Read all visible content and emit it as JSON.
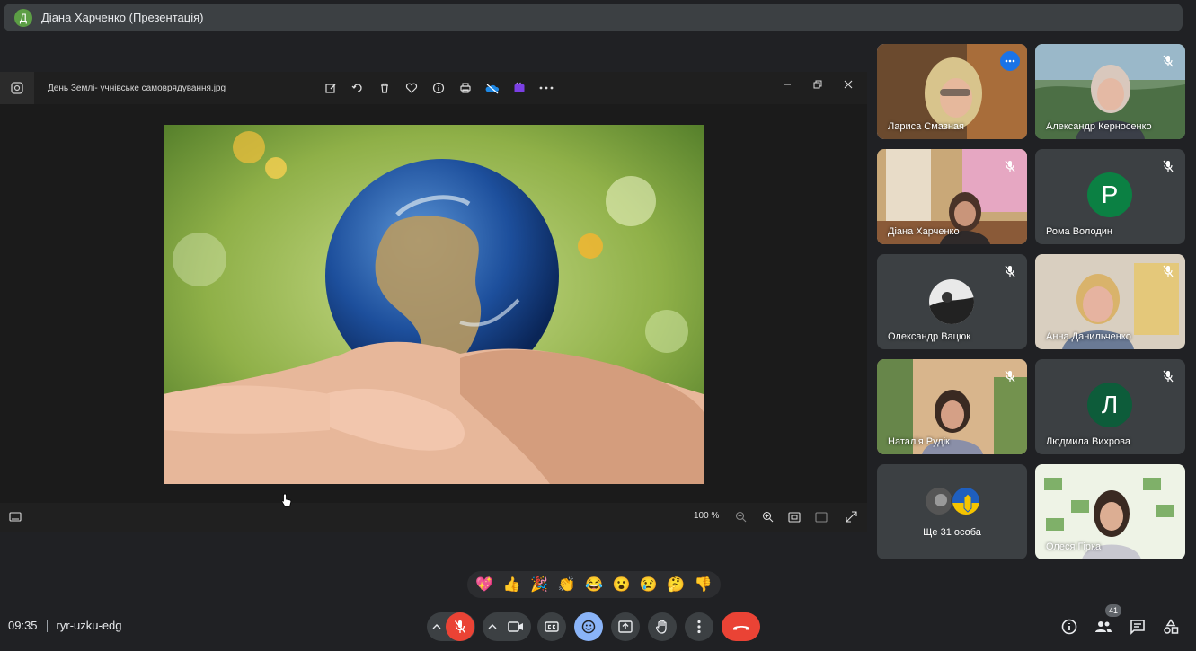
{
  "presenter": {
    "initial": "Д",
    "title": "Діана Харченко (Презентація)"
  },
  "viewer": {
    "file_name": "День Землі- учнівське самоврядування.jpg",
    "tools": [
      "edit-icon",
      "rotate-icon",
      "delete-icon",
      "favorite-icon",
      "info-icon",
      "print-icon",
      "onedrive-icon",
      "clipchamp-icon",
      "more-icon"
    ],
    "zoom_label": "100 %"
  },
  "participants": [
    {
      "name": "Лариса Смазная",
      "muted": false,
      "active": true
    },
    {
      "name": "Александр Керносенко",
      "muted": true
    },
    {
      "name": "Діана Харченко",
      "muted": true
    },
    {
      "name": "Рома Володин",
      "muted": true,
      "initial": "P",
      "avatar_color": "#0b8043"
    },
    {
      "name": "Олександр Вацюк",
      "muted": true
    },
    {
      "name": "Анна Данильченко",
      "muted": true
    },
    {
      "name": "Наталія Рудік",
      "muted": true
    },
    {
      "name": "Людмила Вихрова",
      "muted": true,
      "initial": "Л",
      "avatar_color": "#0d5c3a"
    },
    {
      "name": "Ще 31 особа",
      "muted": false
    },
    {
      "name": "Олеся Гірка",
      "muted": false
    }
  ],
  "reactions": [
    "💖",
    "👍",
    "🎉",
    "👏",
    "😂",
    "😮",
    "😢",
    "🤔",
    "👎"
  ],
  "meeting": {
    "time": "09:35",
    "code": "ryr-uzku-edg",
    "people_count": "41"
  },
  "colors": {
    "end_call": "#ea4335",
    "mic_off": "#ea4335",
    "active_border": "#8ab4f8"
  }
}
